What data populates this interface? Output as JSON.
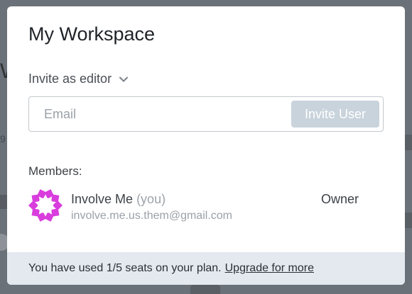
{
  "modal": {
    "title": "My Workspace",
    "role_select": {
      "label": "Invite as editor",
      "icon": "chevron-down-icon"
    },
    "email_input": {
      "placeholder": "Email",
      "value": ""
    },
    "invite_button_label": "Invite User",
    "members_label": "Members:",
    "members": [
      {
        "name": "Involve Me",
        "you_tag": "(you)",
        "email": "involve.me.us.them@gmail.com",
        "role": "Owner",
        "avatar_icon": "involve-me-logo",
        "avatar_color": "#d93ddd"
      }
    ],
    "footer": {
      "text": "You have used 1/5 seats on your plan.",
      "link": "Upgrade for more"
    }
  },
  "colors": {
    "overlay": "#6b7178",
    "invite_button_bg": "#c9d3dc",
    "footer_bg": "#e3e9ef"
  }
}
